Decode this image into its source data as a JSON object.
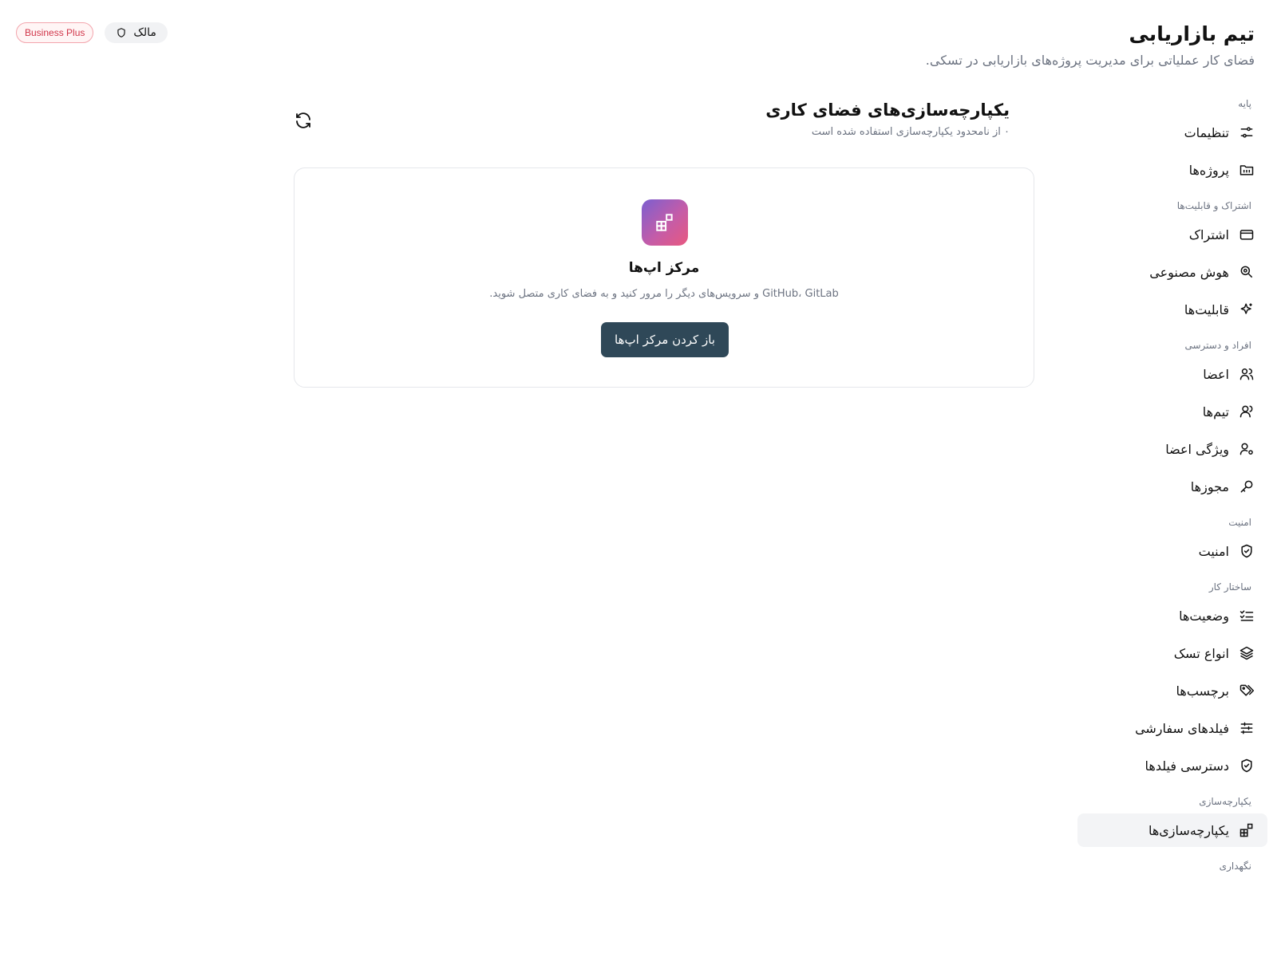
{
  "workspace": {
    "title": "تیم بازاریابی",
    "subtitle": "فضای کار عملیاتی برای مدیریت پروژه‌های بازاریابی در تسکی."
  },
  "badges": {
    "role": "مالک",
    "plan": "Business Plus"
  },
  "sidebar": {
    "sections": [
      {
        "label": "پایه",
        "items": [
          {
            "label": "تنظیمات",
            "icon": "settings-sliders-icon"
          },
          {
            "label": "پروژه‌ها",
            "icon": "folder-icon"
          }
        ]
      },
      {
        "label": "اشتراک و قابلیت‌ها",
        "items": [
          {
            "label": "اشتراک",
            "icon": "credit-card-icon"
          },
          {
            "label": "هوش مصنوعی",
            "icon": "ai-icon"
          },
          {
            "label": "قابلیت‌ها",
            "icon": "sparkles-icon"
          }
        ]
      },
      {
        "label": "افراد و دسترسی",
        "items": [
          {
            "label": "اعضا",
            "icon": "users-icon"
          },
          {
            "label": "تیم‌ها",
            "icon": "team-icon"
          },
          {
            "label": "ویژگی اعضا",
            "icon": "user-cog-icon"
          },
          {
            "label": "مجوزها",
            "icon": "key-icon"
          }
        ]
      },
      {
        "label": "امنیت",
        "items": [
          {
            "label": "امنیت",
            "icon": "shield-check-icon"
          }
        ]
      },
      {
        "label": "ساختار کار",
        "items": [
          {
            "label": "وضعیت‌ها",
            "icon": "list-check-icon"
          },
          {
            "label": "انواع تسک",
            "icon": "layers-icon"
          },
          {
            "label": "برچسب‌ها",
            "icon": "tags-icon"
          },
          {
            "label": "فیلدهای سفارشی",
            "icon": "sliders-icon"
          },
          {
            "label": "دسترسی فیلدها",
            "icon": "shield-check-icon"
          }
        ]
      },
      {
        "label": "یکپارچه‌سازی",
        "items": [
          {
            "label": "یکپارچه‌سازی‌ها",
            "icon": "integrations-icon",
            "active": true
          }
        ]
      },
      {
        "label": "نگهداری",
        "items": []
      }
    ]
  },
  "main": {
    "title": "یکپارچه‌سازی‌های فضای کاری",
    "subtitle": "۰ از نامحدود یکپارچه‌سازی استفاده شده است",
    "card": {
      "title": "مرکز اپ‌ها",
      "description": "GitHub، GitLab و سرویس‌های دیگر را مرور کنید و به فضای کاری متصل شوید.",
      "button_label": "باز کردن مرکز اپ‌ها"
    }
  },
  "colors": {
    "button_bg": "#2f4858",
    "plan_badge": "#d1364a",
    "active_item_bg": "#f3f4f6"
  }
}
